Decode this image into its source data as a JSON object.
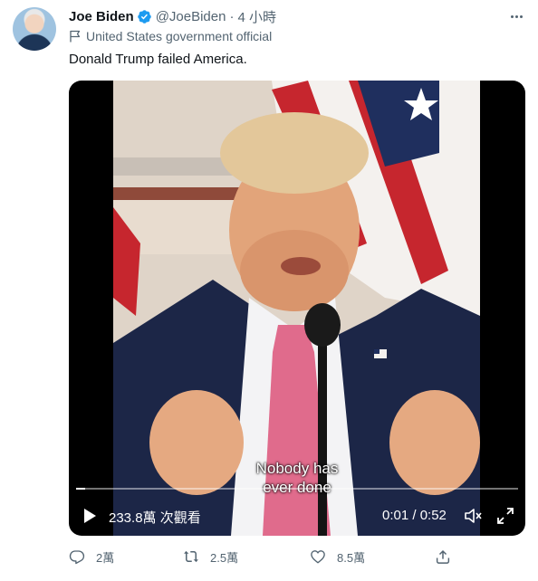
{
  "author": {
    "name": "Joe Biden",
    "handle": "@JoeBiden",
    "separator": "·",
    "time": "4 小時",
    "label": "United States government official"
  },
  "tweet": {
    "text": "Donald Trump failed America."
  },
  "video": {
    "subtitle_line1": "Nobody has",
    "subtitle_line2": "ever done",
    "views": "233.8萬 次觀看",
    "timecode": "0:01 / 0:52",
    "progress": 0.02
  },
  "actions": {
    "replies": "2萬",
    "retweets": "2.5萬",
    "likes": "8.5萬"
  },
  "colors": {
    "verified": "#1d9bf0",
    "secondary_text": "#536471",
    "primary_text": "#0f1419"
  },
  "icons": [
    "verified-badge-icon",
    "more-icon",
    "government-flag-icon",
    "play-icon",
    "volume-icon",
    "fullscreen-icon",
    "reply-icon",
    "retweet-icon",
    "like-icon",
    "share-icon"
  ]
}
